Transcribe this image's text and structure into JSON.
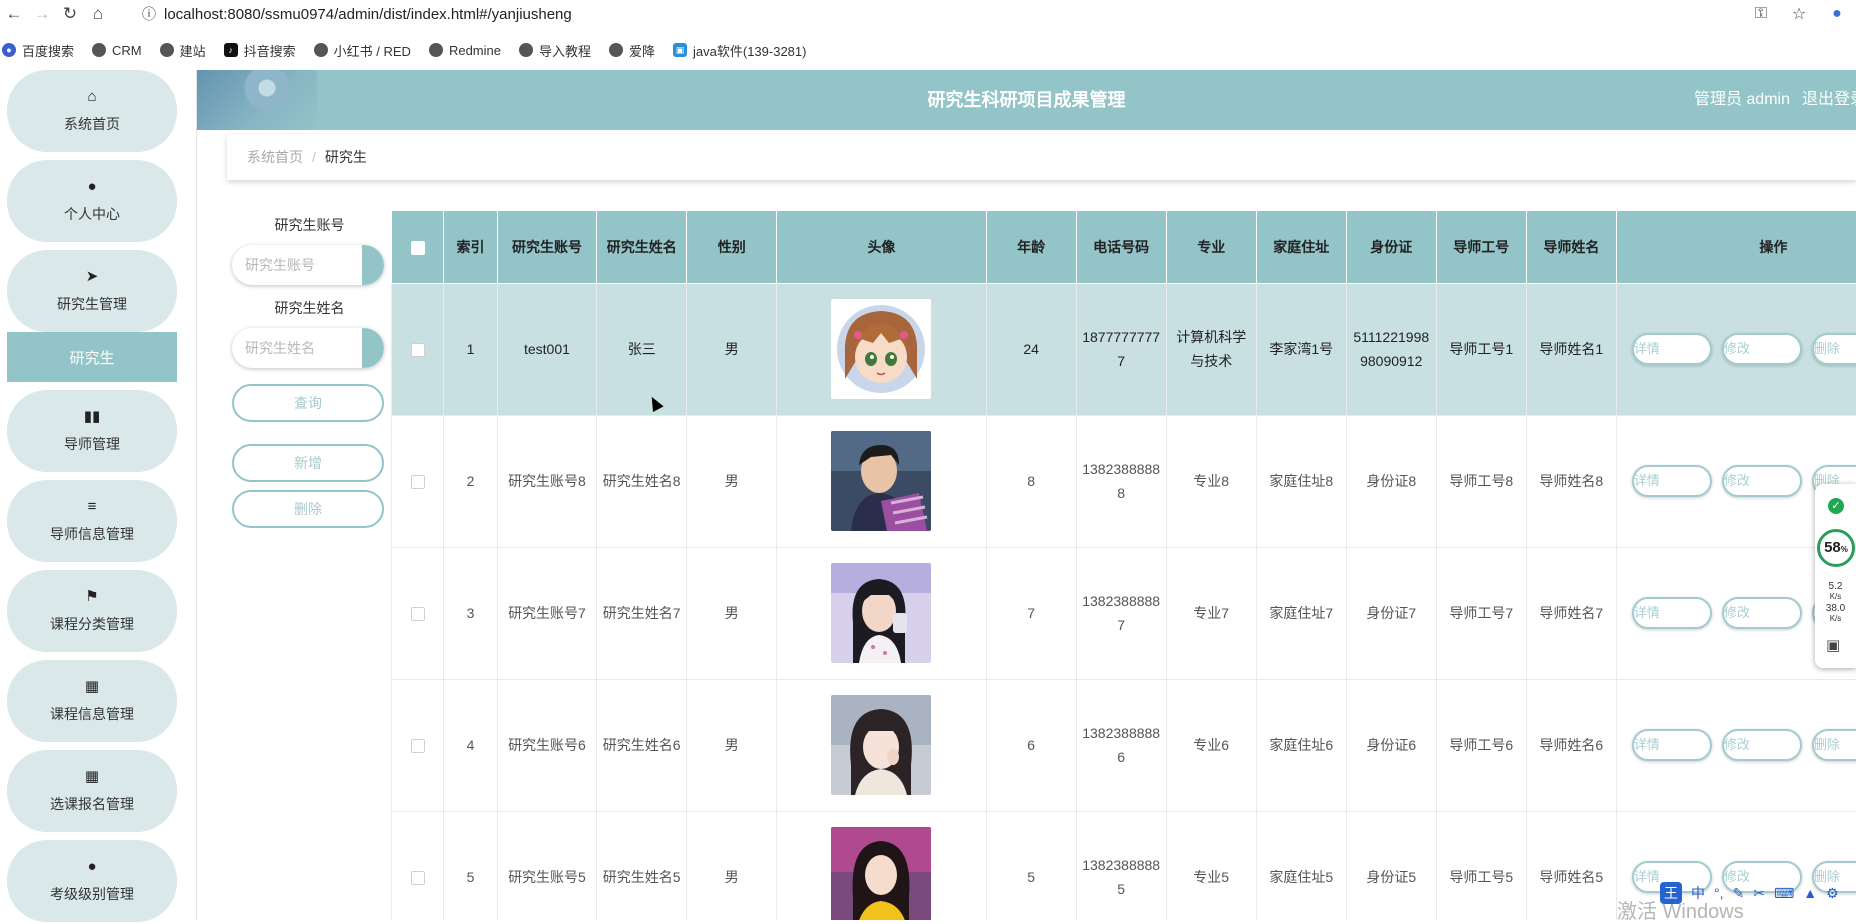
{
  "browser": {
    "url": "localhost:8080/ssmu0974/admin/dist/index.html#/yanjiusheng",
    "bookmarks": [
      "百度搜索",
      "CRM",
      "建站",
      "抖音搜索",
      "小红书 / RED",
      "Redmine",
      "导入教程",
      "爱降",
      "java软件(139-3281)"
    ]
  },
  "header": {
    "title": "研究生科研项目成果管理",
    "user": "管理员 admin",
    "logout": "退出登录"
  },
  "sidebar": {
    "items": [
      {
        "label": "系统首页",
        "icon": "home-icon"
      },
      {
        "label": "个人中心",
        "icon": "user-icon"
      },
      {
        "label": "研究生管理",
        "icon": "send-icon"
      },
      {
        "label": "导师管理",
        "icon": "book-icon"
      },
      {
        "label": "导师信息管理",
        "icon": "sliders-icon"
      },
      {
        "label": "课程分类管理",
        "icon": "flag-icon"
      },
      {
        "label": "课程信息管理",
        "icon": "grid-icon"
      },
      {
        "label": "选课报名管理",
        "icon": "grid-icon"
      },
      {
        "label": "考级级别管理",
        "icon": "user-icon"
      }
    ],
    "sub_active": "研究生"
  },
  "breadcrumb": {
    "home": "系统首页",
    "sep": "/",
    "current": "研究生"
  },
  "search": {
    "account_label": "研究生账号",
    "account_placeholder": "研究生账号",
    "name_label": "研究生姓名",
    "name_placeholder": "研究生姓名",
    "query_btn": "查询",
    "add_btn": "新增",
    "delete_btn": "删除"
  },
  "table": {
    "headers": [
      "索引",
      "研究生账号",
      "研究生姓名",
      "性别",
      "头像",
      "年龄",
      "电话号码",
      "专业",
      "家庭住址",
      "身份证",
      "导师工号",
      "导师姓名",
      "操作"
    ],
    "actions": {
      "detail": "详情",
      "edit": "修改",
      "delete": "删除"
    },
    "rows": [
      {
        "index": "1",
        "account": "test001",
        "name": "张三",
        "gender": "男",
        "age": "24",
        "phone": "18777777777",
        "major": "计算机科学与技术",
        "address": "李家湾1号",
        "id_card": "511122199898090912",
        "tutor_no": "导师工号1",
        "tutor_name": "导师姓名1",
        "avatar": "cartoon-girl-avatar"
      },
      {
        "index": "2",
        "account": "研究生账号8",
        "name": "研究生姓名8",
        "gender": "男",
        "age": "8",
        "phone": "13823888888",
        "major": "专业8",
        "address": "家庭住址8",
        "id_card": "身份证8",
        "tutor_no": "导师工号8",
        "tutor_name": "导师姓名8",
        "avatar": "photo-boy-avatar"
      },
      {
        "index": "3",
        "account": "研究生账号7",
        "name": "研究生姓名7",
        "gender": "男",
        "age": "7",
        "phone": "13823888887",
        "major": "专业7",
        "address": "家庭住址7",
        "id_card": "身份证7",
        "tutor_no": "导师工号7",
        "tutor_name": "导师姓名7",
        "avatar": "photo-girl-avatar"
      },
      {
        "index": "4",
        "account": "研究生账号6",
        "name": "研究生姓名6",
        "gender": "男",
        "age": "6",
        "phone": "13823888886",
        "major": "专业6",
        "address": "家庭住址6",
        "id_card": "身份证6",
        "tutor_no": "导师工号6",
        "tutor_name": "导师姓名6",
        "avatar": "photo-girl-avatar"
      },
      {
        "index": "5",
        "account": "研究生账号5",
        "name": "研究生姓名5",
        "gender": "男",
        "age": "5",
        "phone": "13823888885",
        "major": "专业5",
        "address": "家庭住址5",
        "id_card": "身份证5",
        "tutor_no": "导师工号5",
        "tutor_name": "导师姓名5",
        "avatar": "photo-girl-avatar"
      }
    ]
  },
  "widgets": {
    "perf_percent": "58",
    "perf_unit": "%",
    "net_up": "5.2",
    "net_down": "38.0",
    "net_unit": "K/s",
    "ime_label": "中",
    "watermark": "激活 Windows"
  },
  "colors": {
    "accent": "#93c4c8",
    "menu_bg": "#dbe8e9",
    "selected_row": "#c8e0e2"
  }
}
